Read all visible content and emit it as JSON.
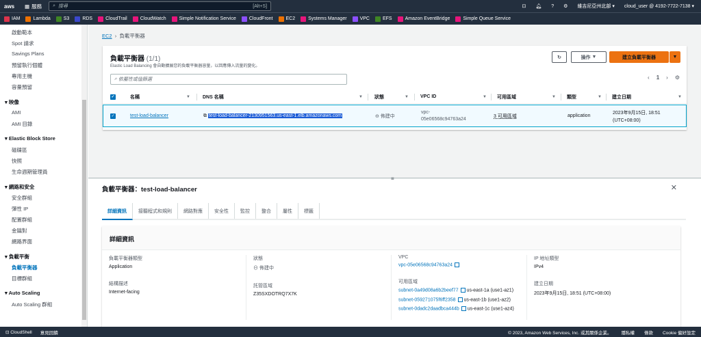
{
  "topnav": {
    "logo": "aws",
    "services": "服務",
    "search_placeholder": "搜尋",
    "search_shortcut": "[Alt+S]",
    "region": "維吉尼亞州北部",
    "account": "cloud_user @ 4192-7722-7138"
  },
  "favorites": [
    {
      "label": "IAM",
      "color": "#dd344c"
    },
    {
      "label": "Lambda",
      "color": "#ed7100"
    },
    {
      "label": "S3",
      "color": "#3f8624"
    },
    {
      "label": "RDS",
      "color": "#3b48cc"
    },
    {
      "label": "CloudTrail",
      "color": "#e7157b"
    },
    {
      "label": "CloudWatch",
      "color": "#e7157b"
    },
    {
      "label": "Simple Notification Service",
      "color": "#e7157b"
    },
    {
      "label": "CloudFront",
      "color": "#8c4fff"
    },
    {
      "label": "EC2",
      "color": "#ed7100"
    },
    {
      "label": "Systems Manager",
      "color": "#e7157b"
    },
    {
      "label": "VPC",
      "color": "#8c4fff"
    },
    {
      "label": "EFS",
      "color": "#3f8624"
    },
    {
      "label": "Amazon EventBridge",
      "color": "#e7157b"
    },
    {
      "label": "Simple Queue Service",
      "color": "#e7157b"
    }
  ],
  "sidebar": {
    "items": [
      "啟動範本",
      "Spot 請求",
      "Savings Plans",
      "預留執行個體",
      "專用主機",
      "容量預留"
    ],
    "sections": [
      {
        "title": "映像",
        "items": [
          "AMI",
          "AMI 目錄"
        ]
      },
      {
        "title": "Elastic Block Store",
        "items": [
          "磁碟區",
          "快照",
          "生命週期管理員"
        ]
      },
      {
        "title": "網路和安全",
        "items": [
          "安全群組",
          "彈性 IP",
          "配置群組",
          "金鑰對",
          "網路界面"
        ]
      },
      {
        "title": "負載平衡",
        "items": [
          "負載平衡器",
          "目標群組"
        ]
      },
      {
        "title": "Auto Scaling",
        "items": [
          "Auto Scaling 群組"
        ]
      }
    ]
  },
  "breadcrumb": {
    "root": "EC2",
    "current": "負載平衡器"
  },
  "list": {
    "title": "負載平衡器",
    "count": "(1/1)",
    "description": "Elastic Load Balancing 會自動擴展您的負載平衡器容量，以回應傳入流量的變化。",
    "actions": "操作",
    "create": "建立負載平衡器",
    "filter_placeholder": "依屬性或值篩選",
    "page": "1",
    "columns": [
      "名稱",
      "DNS 名稱",
      "狀態",
      "VPC ID",
      "可用區域",
      "類型",
      "建立日期"
    ],
    "rows": [
      {
        "name": "test-load-balancer",
        "dns": "test-load-balancer-2130951563.us-east-1.elb.amazonaws.com",
        "state": "佈建中",
        "vpc1": "vpc-",
        "vpc2": "05e06568c94763a24",
        "azs": "3 可用區域",
        "type": "application",
        "date1": "2023年9月15日, 18:51",
        "date2": "(UTC+08:00)"
      }
    ]
  },
  "detail": {
    "title": "負載平衡器：test-load-balancer",
    "tabs": [
      "詳細資訊",
      "接聽程式和規則",
      "網路對應",
      "安全性",
      "監控",
      "整合",
      "屬性",
      "標籤"
    ],
    "section": "詳細資訊",
    "type_label": "負載平衡器類型",
    "type": "Application",
    "scheme_label": "結構描述",
    "scheme": "Internet-facing",
    "state_label": "狀態",
    "state": "佈建中",
    "zone_label": "託管區域",
    "zone": "Z35SXDOTRQ7X7K",
    "vpc_label": "VPC",
    "vpc": "vpc-05e06568c94763a24",
    "az_label": "可用區域",
    "subnets": [
      {
        "id": "subnet-0a49d08a6b2beef77",
        "az": "us-east-1a (use1-az1)"
      },
      {
        "id": "subnet-059271075f6ff2358",
        "az": "us-east-1b (use1-az2)"
      },
      {
        "id": "subnet-0dadc2daadbca444b",
        "az": "us-east-1c (use1-az4)"
      }
    ],
    "ip_label": "IP 地址類型",
    "ip": "IPv4",
    "date_label": "建立日期",
    "date": "2023年9月15日, 18:51 (UTC+08:00)"
  },
  "footer": {
    "cloudshell": "CloudShell",
    "feedback": "意見回饋",
    "copyright": "© 2023, Amazon Web Services, Inc. 或其關係企業。",
    "privacy": "隱私權",
    "terms": "條款",
    "cookie": "Cookie 偏好設定"
  }
}
